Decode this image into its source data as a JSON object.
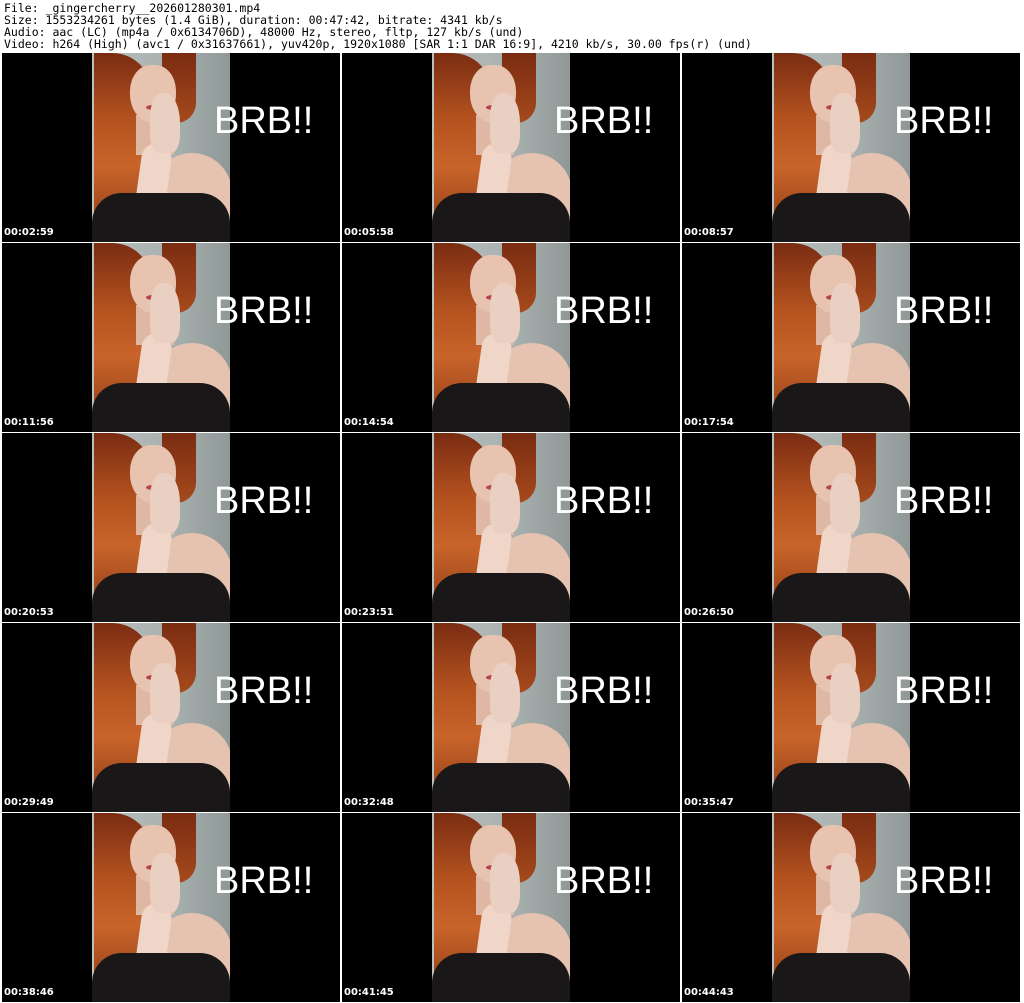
{
  "header": {
    "file_line": "File: _gingercherry__202601280301.mp4",
    "size_line": "Size: 1553234261 bytes (1.4 GiB), duration: 00:47:42, bitrate: 4341 kb/s",
    "audio_line": "Audio: aac (LC) (mp4a / 0x6134706D), 48000 Hz, stereo, fltp, 127 kb/s (und)",
    "video_line": "Video: h264 (High) (avc1 / 0x31637661), yuv420p, 1920x1080 [SAR 1:1 DAR 16:9], 4210 kb/s, 30.00 fps(r) (und)"
  },
  "thumbnails": [
    {
      "caption": "BRB!!",
      "timestamp": "00:02:59"
    },
    {
      "caption": "BRB!!",
      "timestamp": "00:05:58"
    },
    {
      "caption": "BRB!!",
      "timestamp": "00:08:57"
    },
    {
      "caption": "BRB!!",
      "timestamp": "00:11:56"
    },
    {
      "caption": "BRB!!",
      "timestamp": "00:14:54"
    },
    {
      "caption": "BRB!!",
      "timestamp": "00:17:54"
    },
    {
      "caption": "BRB!!",
      "timestamp": "00:20:53"
    },
    {
      "caption": "BRB!!",
      "timestamp": "00:23:51"
    },
    {
      "caption": "BRB!!",
      "timestamp": "00:26:50"
    },
    {
      "caption": "BRB!!",
      "timestamp": "00:29:49"
    },
    {
      "caption": "BRB!!",
      "timestamp": "00:32:48"
    },
    {
      "caption": "BRB!!",
      "timestamp": "00:35:47"
    },
    {
      "caption": "BRB!!",
      "timestamp": "00:38:46"
    },
    {
      "caption": "BRB!!",
      "timestamp": "00:41:45"
    },
    {
      "caption": "BRB!!",
      "timestamp": "00:44:43"
    }
  ]
}
